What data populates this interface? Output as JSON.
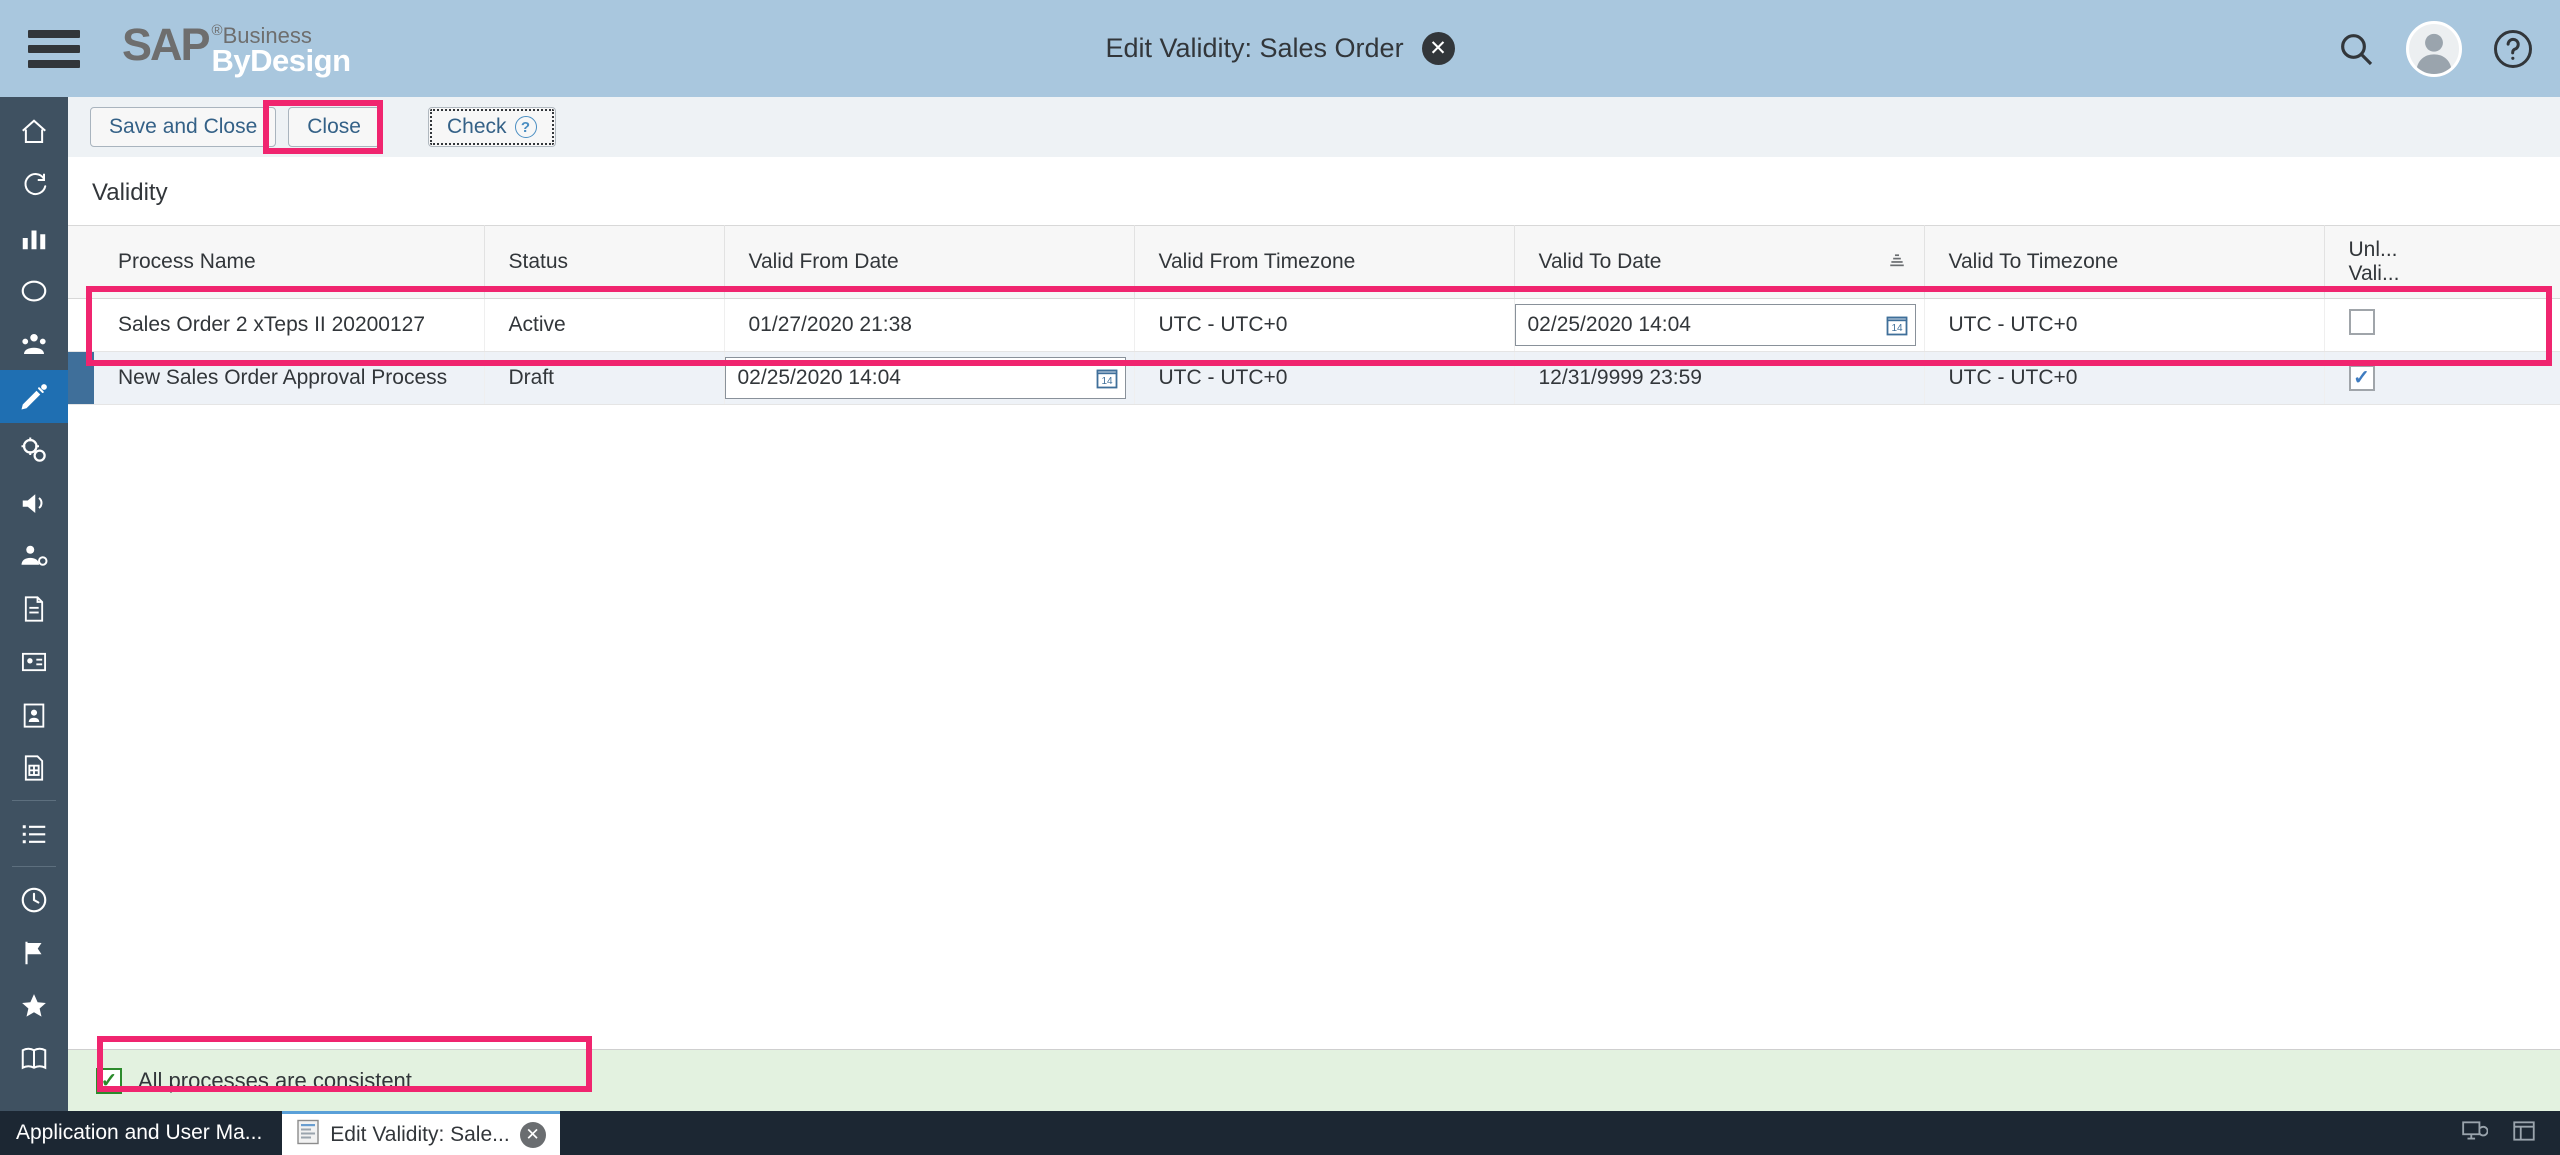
{
  "header": {
    "title": "Edit Validity: Sales Order",
    "close_label": "✕",
    "logo_sap": "SAP",
    "logo_reg": "®",
    "logo_business": "Business",
    "logo_bydesign": "ByDesign",
    "menu_icon": "hamburger-menu-icon",
    "search_icon": "search-icon",
    "avatar_icon": "user-avatar-icon",
    "help_icon": "help-icon",
    "background_color": "#a9c7de"
  },
  "sidebar": {
    "background_color": "#3f5161",
    "active_color": "#1f6fb2",
    "items": [
      {
        "icon": "home-icon",
        "active": false
      },
      {
        "icon": "refresh-activity-icon",
        "active": false
      },
      {
        "icon": "bar-chart-icon",
        "active": false
      },
      {
        "icon": "circle-icon",
        "active": false
      },
      {
        "icon": "people-group-icon",
        "active": false
      },
      {
        "icon": "process-edit-icon",
        "active": true
      },
      {
        "icon": "gears-settings-icon",
        "active": false
      },
      {
        "icon": "megaphone-icon",
        "active": false
      },
      {
        "icon": "user-settings-icon",
        "active": false
      },
      {
        "icon": "document-icon",
        "active": false
      },
      {
        "icon": "id-card-icon",
        "active": false
      },
      {
        "icon": "contact-card-icon",
        "active": false
      },
      {
        "icon": "calculator-document-icon",
        "active": false
      },
      {
        "icon": "list-icon",
        "active": false
      },
      {
        "icon": "clock-icon",
        "active": false
      },
      {
        "icon": "flag-icon",
        "active": false
      },
      {
        "icon": "star-icon",
        "active": false
      },
      {
        "icon": "book-icon",
        "active": false
      }
    ]
  },
  "toolbar": {
    "save_and_close_label": "Save and Close",
    "close_label": "Close",
    "check_label": "Check",
    "check_help_icon": "question-mark-icon"
  },
  "main": {
    "section_title": "Validity",
    "table": {
      "columns": [
        {
          "label": "Process Name",
          "sorted": false
        },
        {
          "label": "Status",
          "sorted": false
        },
        {
          "label": "Valid From Date",
          "sorted": false
        },
        {
          "label": "Valid From Timezone",
          "sorted": false
        },
        {
          "label": "Valid To Date",
          "sorted": true,
          "sort_icon": "sort-ascending-icon"
        },
        {
          "label": "Valid To Timezone",
          "sorted": false
        },
        {
          "label": "Unl...",
          "label2": "Vali...",
          "sorted": false
        }
      ],
      "rows": [
        {
          "selected": false,
          "process_name": "Sales Order 2 xTeps II 20200127",
          "status": "Active",
          "valid_from_date": "01/27/2020 21:38",
          "valid_from_date_editable": false,
          "valid_from_timezone": "UTC - UTC+0",
          "valid_to_date": "02/25/2020 14:04",
          "valid_to_date_editable": true,
          "valid_to_timezone": "UTC - UTC+0",
          "unlimited_validity": false,
          "calendar_icon": "calendar-icon",
          "calendar_day": "14"
        },
        {
          "selected": true,
          "process_name": "New Sales Order Approval Process",
          "status": "Draft",
          "valid_from_date": "02/25/2020 14:04",
          "valid_from_date_editable": true,
          "valid_from_timezone": "UTC - UTC+0",
          "valid_to_date": "12/31/9999 23:59",
          "valid_to_date_editable": false,
          "valid_to_timezone": "UTC - UTC+0",
          "unlimited_validity": true,
          "calendar_icon": "calendar-icon",
          "calendar_day": "14"
        }
      ]
    }
  },
  "status": {
    "message": "All processes are consistent",
    "icon": "green-check-icon",
    "background_color": "#e3f2e0"
  },
  "taskbar": {
    "background_color": "#1c2733",
    "app_label": "Application and User Ma...",
    "tab_label": "Edit Validity: Sale...",
    "tab_icon": "document-list-icon",
    "tab_close_label": "✕",
    "right_icons": [
      {
        "icon": "monitor-sync-icon"
      },
      {
        "icon": "window-restore-icon"
      }
    ]
  },
  "annotations": {
    "color": "#f0256f",
    "boxes": [
      "check-button-highlight",
      "table-rows-highlight",
      "status-message-highlight"
    ]
  }
}
